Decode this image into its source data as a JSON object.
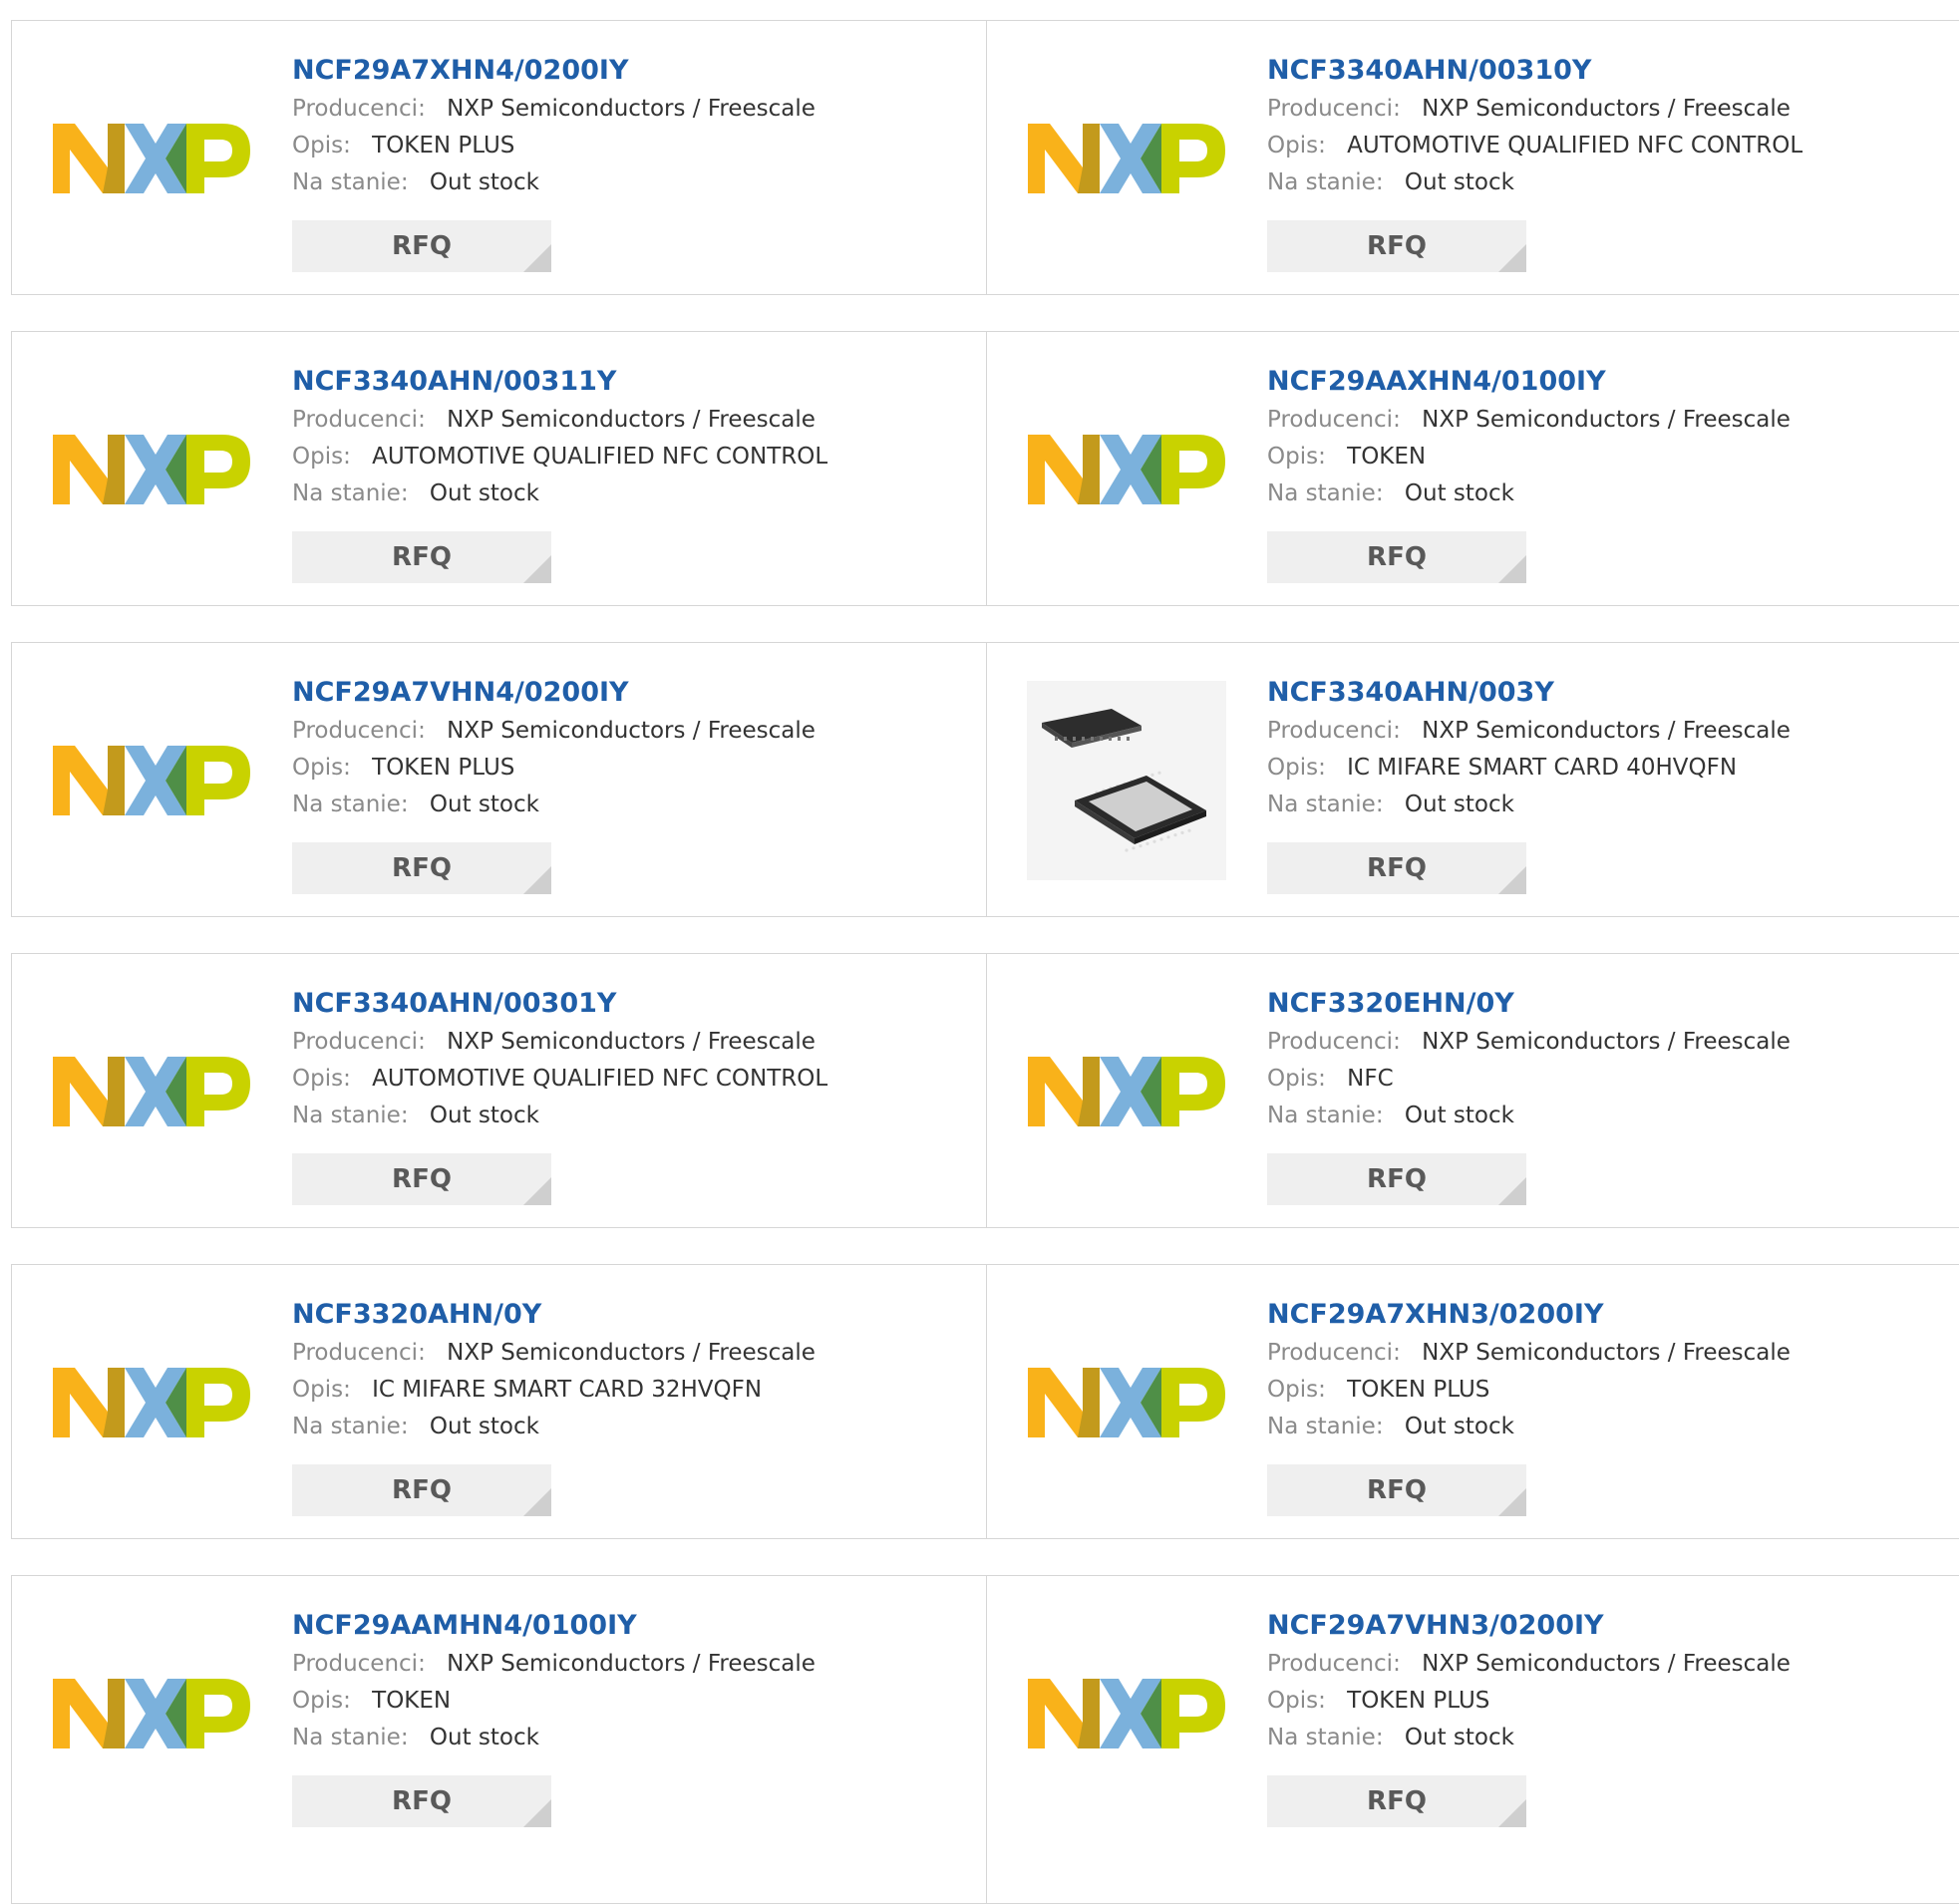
{
  "labels": {
    "manufacturer": "Producenci:",
    "description": "Opis:",
    "stock": "Na stanie:",
    "rfq": "RFQ"
  },
  "brand_colors": {
    "nxp_orange": "#f9b21a",
    "nxp_blue": "#7bb1dc",
    "nxp_green": "#c9d200"
  },
  "products": [
    {
      "part": "NCF29A7XHN4/0200IY",
      "manufacturer": "NXP Semiconductors / Freescale",
      "description": "TOKEN PLUS",
      "stock": "Out stock",
      "image": "nxp-logo"
    },
    {
      "part": "NCF3340AHN/00310Y",
      "manufacturer": "NXP Semiconductors / Freescale",
      "description": "AUTOMOTIVE QUALIFIED NFC CONTROL",
      "stock": "Out stock",
      "image": "nxp-logo"
    },
    {
      "part": "NCF3340AHN/00311Y",
      "manufacturer": "NXP Semiconductors / Freescale",
      "description": "AUTOMOTIVE QUALIFIED NFC CONTROL",
      "stock": "Out stock",
      "image": "nxp-logo"
    },
    {
      "part": "NCF29AAXHN4/0100IY",
      "manufacturer": "NXP Semiconductors / Freescale",
      "description": "TOKEN",
      "stock": "Out stock",
      "image": "nxp-logo"
    },
    {
      "part": "NCF29A7VHN4/0200IY",
      "manufacturer": "NXP Semiconductors / Freescale",
      "description": "TOKEN PLUS",
      "stock": "Out stock",
      "image": "nxp-logo"
    },
    {
      "part": "NCF3340AHN/003Y",
      "manufacturer": "NXP Semiconductors / Freescale",
      "description": "IC MIFARE SMART CARD 40HVQFN",
      "stock": "Out stock",
      "image": "chip-photo"
    },
    {
      "part": "NCF3340AHN/00301Y",
      "manufacturer": "NXP Semiconductors / Freescale",
      "description": "AUTOMOTIVE QUALIFIED NFC CONTROL",
      "stock": "Out stock",
      "image": "nxp-logo"
    },
    {
      "part": "NCF3320EHN/0Y",
      "manufacturer": "NXP Semiconductors / Freescale",
      "description": "NFC",
      "stock": "Out stock",
      "image": "nxp-logo"
    },
    {
      "part": "NCF3320AHN/0Y",
      "manufacturer": "NXP Semiconductors / Freescale",
      "description": "IC MIFARE SMART CARD 32HVQFN",
      "stock": "Out stock",
      "image": "nxp-logo"
    },
    {
      "part": "NCF29A7XHN3/0200IY",
      "manufacturer": "NXP Semiconductors / Freescale",
      "description": "TOKEN PLUS",
      "stock": "Out stock",
      "image": "nxp-logo"
    },
    {
      "part": "NCF29AAMHN4/0100IY",
      "manufacturer": "NXP Semiconductors / Freescale",
      "description": "TOKEN",
      "stock": "Out stock",
      "image": "nxp-logo"
    },
    {
      "part": "NCF29A7VHN3/0200IY",
      "manufacturer": "NXP Semiconductors / Freescale",
      "description": "TOKEN PLUS",
      "stock": "Out stock",
      "image": "nxp-logo"
    }
  ]
}
